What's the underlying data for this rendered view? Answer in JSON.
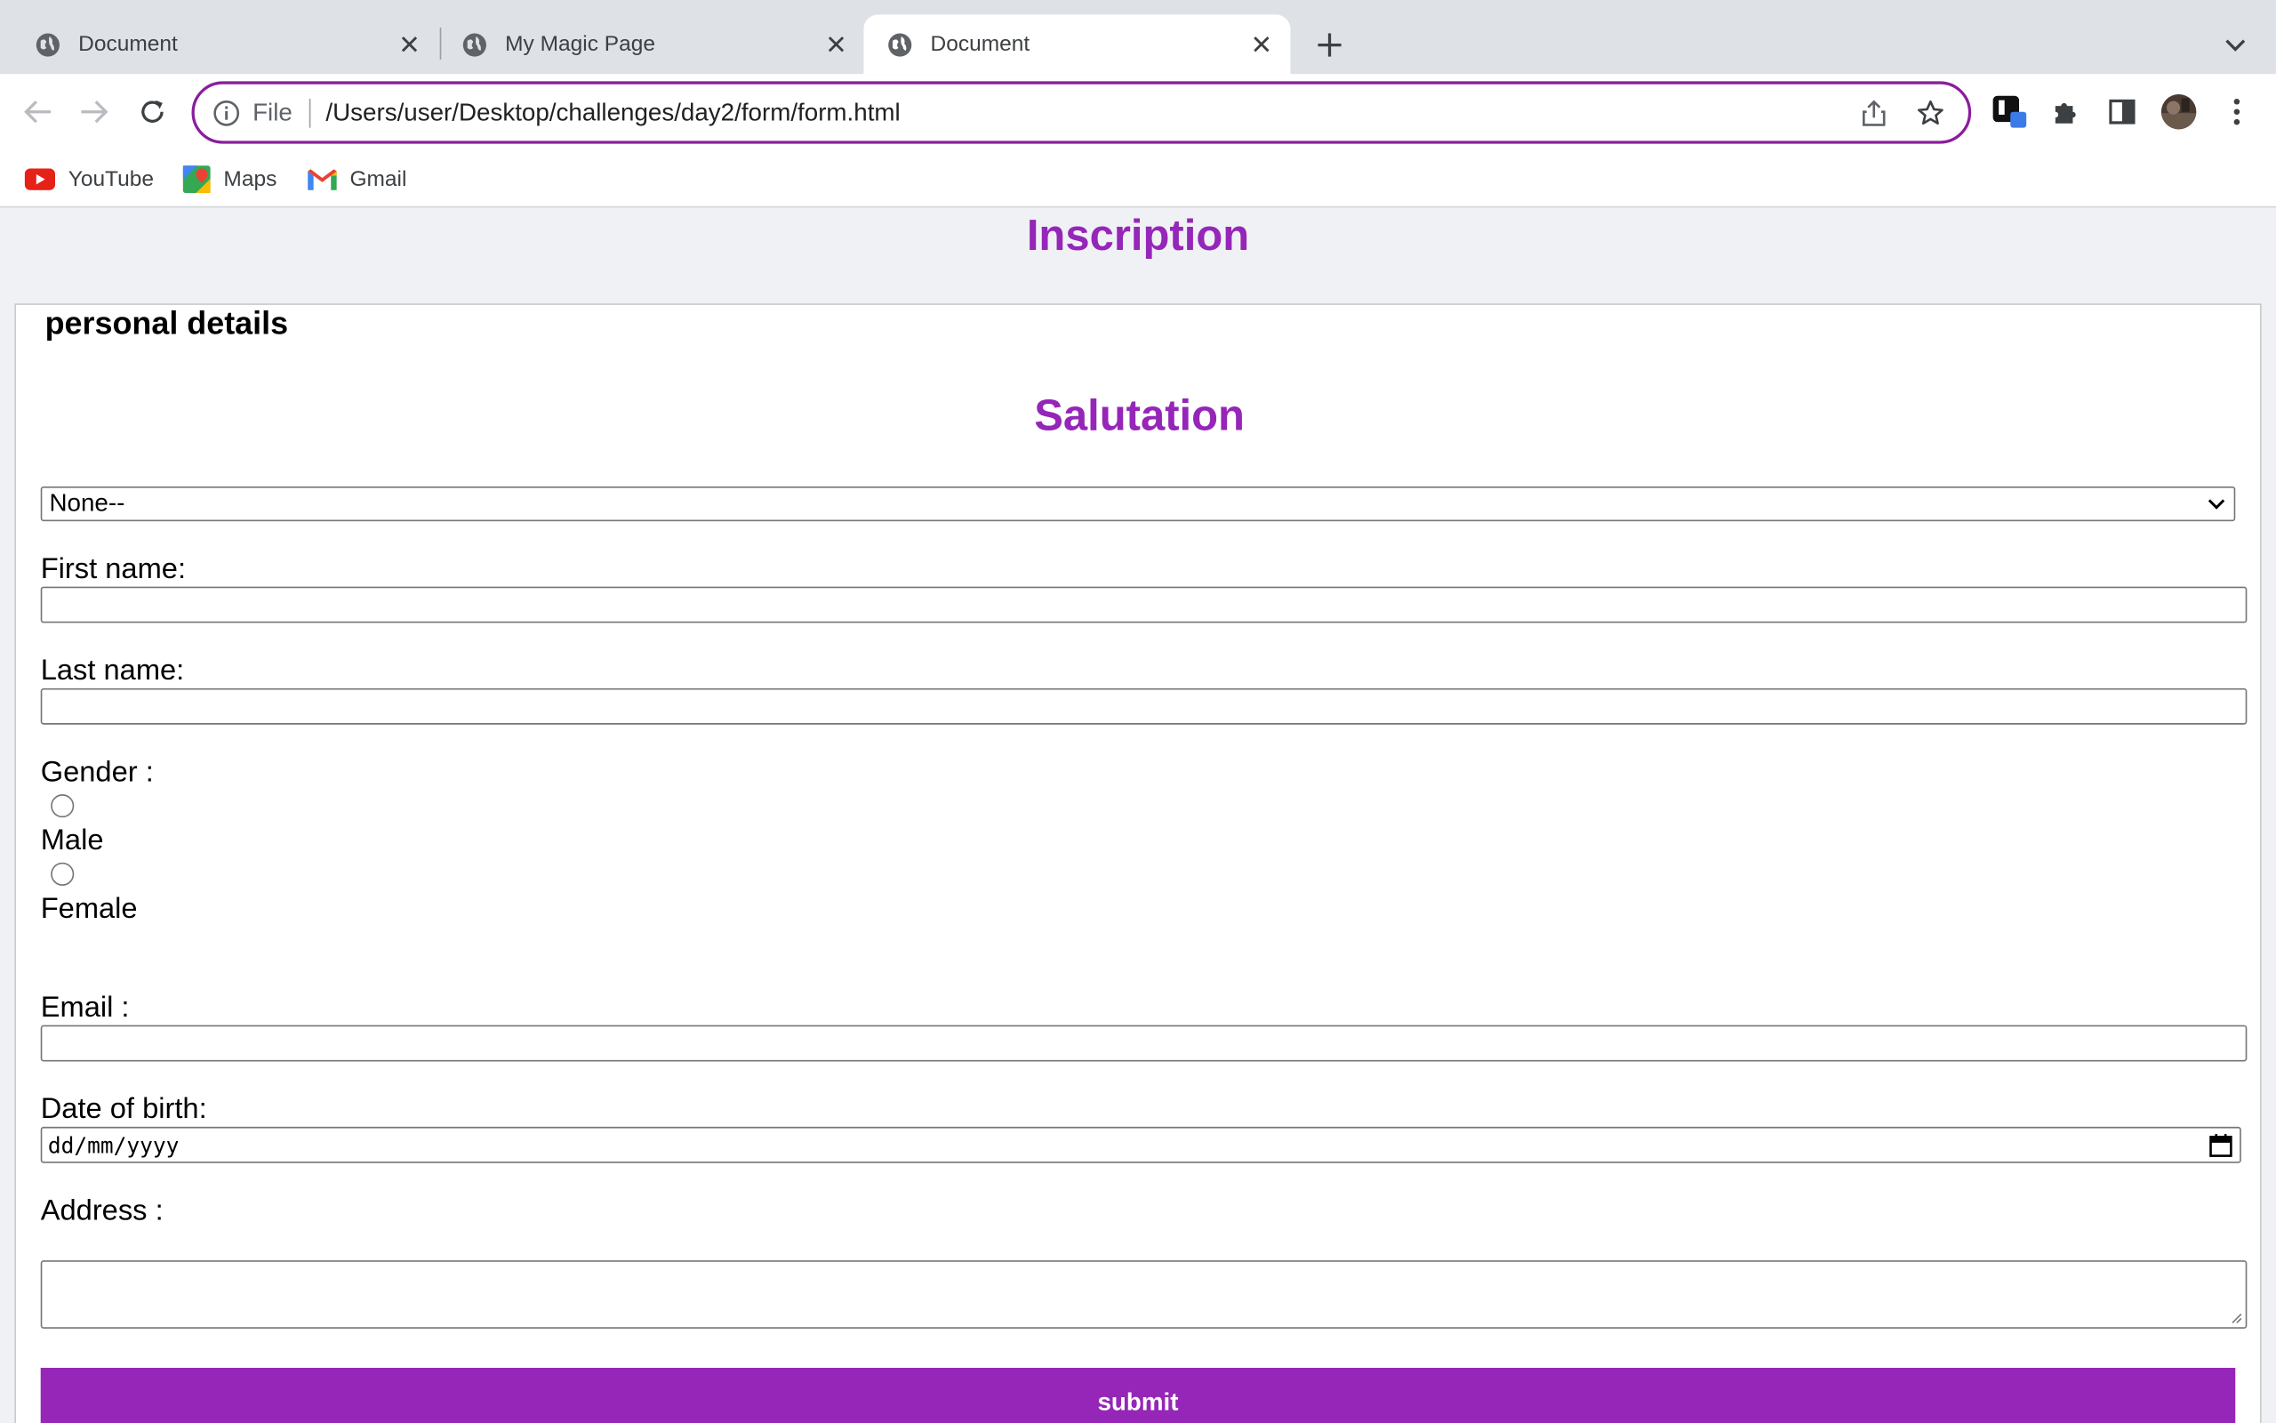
{
  "browser": {
    "tabs": [
      {
        "title": "Document",
        "active": false
      },
      {
        "title": "My Magic Page",
        "active": false
      },
      {
        "title": "Document",
        "active": true
      }
    ],
    "address": {
      "scheme": "File",
      "url": "/Users/user/Desktop/challenges/day2/form/form.html"
    },
    "bookmarks": [
      {
        "label": "YouTube",
        "icon": "youtube-icon"
      },
      {
        "label": "Maps",
        "icon": "maps-icon"
      },
      {
        "label": "Gmail",
        "icon": "gmail-icon"
      }
    ],
    "accent_color": "#8a1e9c"
  },
  "page": {
    "title": "Inscription",
    "legend": "personal details",
    "section_title": "Salutation",
    "salutation": {
      "selected": "None--"
    },
    "first_name": {
      "label": "First name:",
      "value": ""
    },
    "last_name": {
      "label": "Last name:",
      "value": ""
    },
    "gender": {
      "label": "Gender :",
      "options": [
        "Male",
        "Female"
      ]
    },
    "email": {
      "label": "Email :",
      "value": ""
    },
    "dob": {
      "label": "Date of birth:",
      "placeholder": "dd/mm/yyyy"
    },
    "address": {
      "label": "Address :",
      "value": ""
    },
    "submit_label": "submit",
    "theme_color": "#9526b8"
  }
}
